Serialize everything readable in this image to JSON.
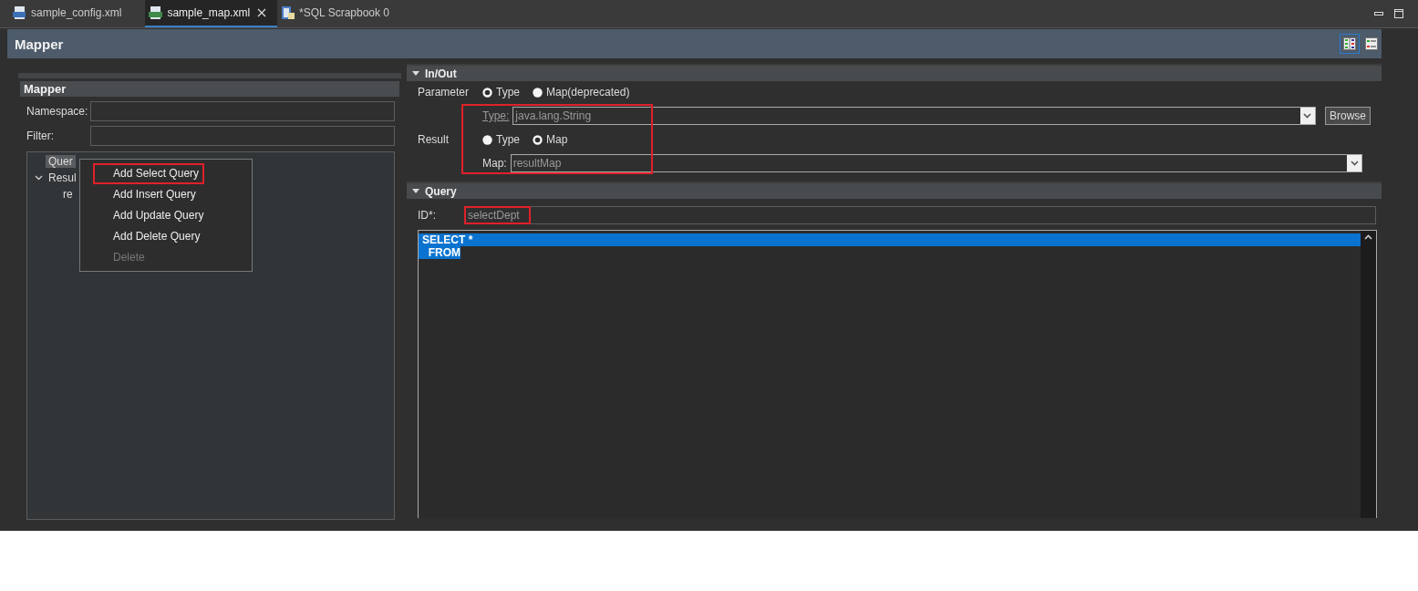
{
  "tabs": [
    {
      "label": "sample_config.xml",
      "selected": false,
      "kind": "config"
    },
    {
      "label": "sample_map.xml",
      "selected": true,
      "kind": "map"
    },
    {
      "label": "*SQL Scrapbook 0",
      "selected": false,
      "kind": "scrapbook"
    }
  ],
  "editor": {
    "title": "Mapper",
    "layouts": [
      {
        "kind": "columns",
        "selected": true
      },
      {
        "kind": "rows",
        "selected": false
      }
    ]
  },
  "mapper": {
    "title": "Mapper",
    "fields": [
      {
        "label": "Namespace:"
      },
      {
        "label": "Filter:"
      }
    ],
    "tree": [
      {
        "label": "Quer",
        "selected": true
      },
      {
        "label": "Resul",
        "selected": false,
        "expanded": true,
        "children": [
          {
            "label": "re",
            "selected": false
          }
        ]
      }
    ]
  },
  "context_menu": {
    "items": [
      {
        "label": "Add Select Query",
        "disabled": false,
        "highlighted": true
      },
      {
        "label": "Add Insert Query",
        "disabled": false,
        "highlighted": false
      },
      {
        "label": "Add Update Query",
        "disabled": false,
        "highlighted": false
      },
      {
        "label": "Add Delete Query",
        "disabled": false,
        "highlighted": false
      },
      {
        "label": "Delete",
        "disabled": true,
        "highlighted": false
      }
    ]
  },
  "in_out": {
    "title": "In/Out",
    "expanded": true,
    "highlighted": true,
    "parameter": {
      "label": "Parameter",
      "options": [
        {
          "label": "Type",
          "selected": true
        },
        {
          "label": "Map(deprecated)",
          "selected": false
        }
      ]
    },
    "type": {
      "label": "Type:",
      "value": "java.lang.String",
      "button": "Browse"
    },
    "result": {
      "label": "Result",
      "options": [
        {
          "label": "Type",
          "selected": false
        },
        {
          "label": "Map",
          "selected": true
        }
      ]
    },
    "map": {
      "label": "Map:",
      "value": "resultMap"
    }
  },
  "query": {
    "title": "Query",
    "expanded": true,
    "id": {
      "label": "ID*:",
      "value": "selectDept",
      "highlighted": true
    },
    "lines": [
      {
        "text": "SELECT *",
        "selected": true
      },
      {
        "text": "  FROM",
        "selected": true
      }
    ]
  }
}
